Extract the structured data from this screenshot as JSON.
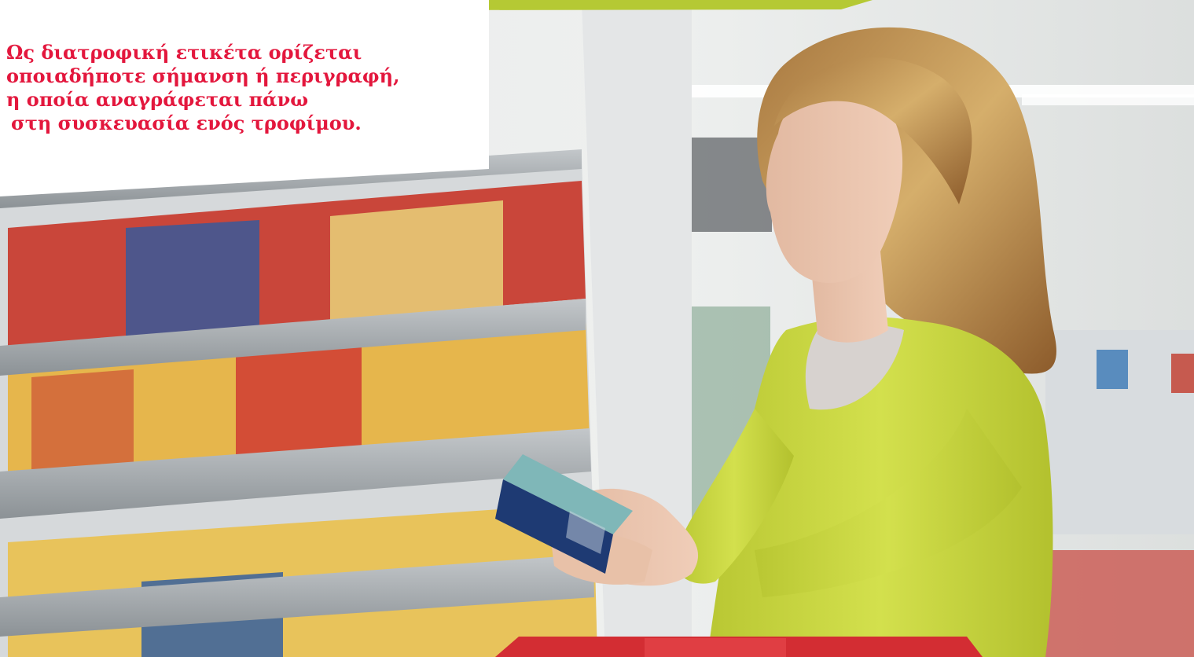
{
  "caption": {
    "lines": [
      "Ως διατροφική ετικέτα ορίζεται",
      "οποιαδήποτε σήμανση ή περιγραφή,",
      "η οποία αναγράφεται πάνω",
      "στη συσκευασία ενός τροφίμου."
    ]
  },
  "colors": {
    "caption_text": "#e3173d",
    "top_band": "#b5c934",
    "sweater": "#cedb43",
    "shelf_metal": "#a9aeb2"
  }
}
